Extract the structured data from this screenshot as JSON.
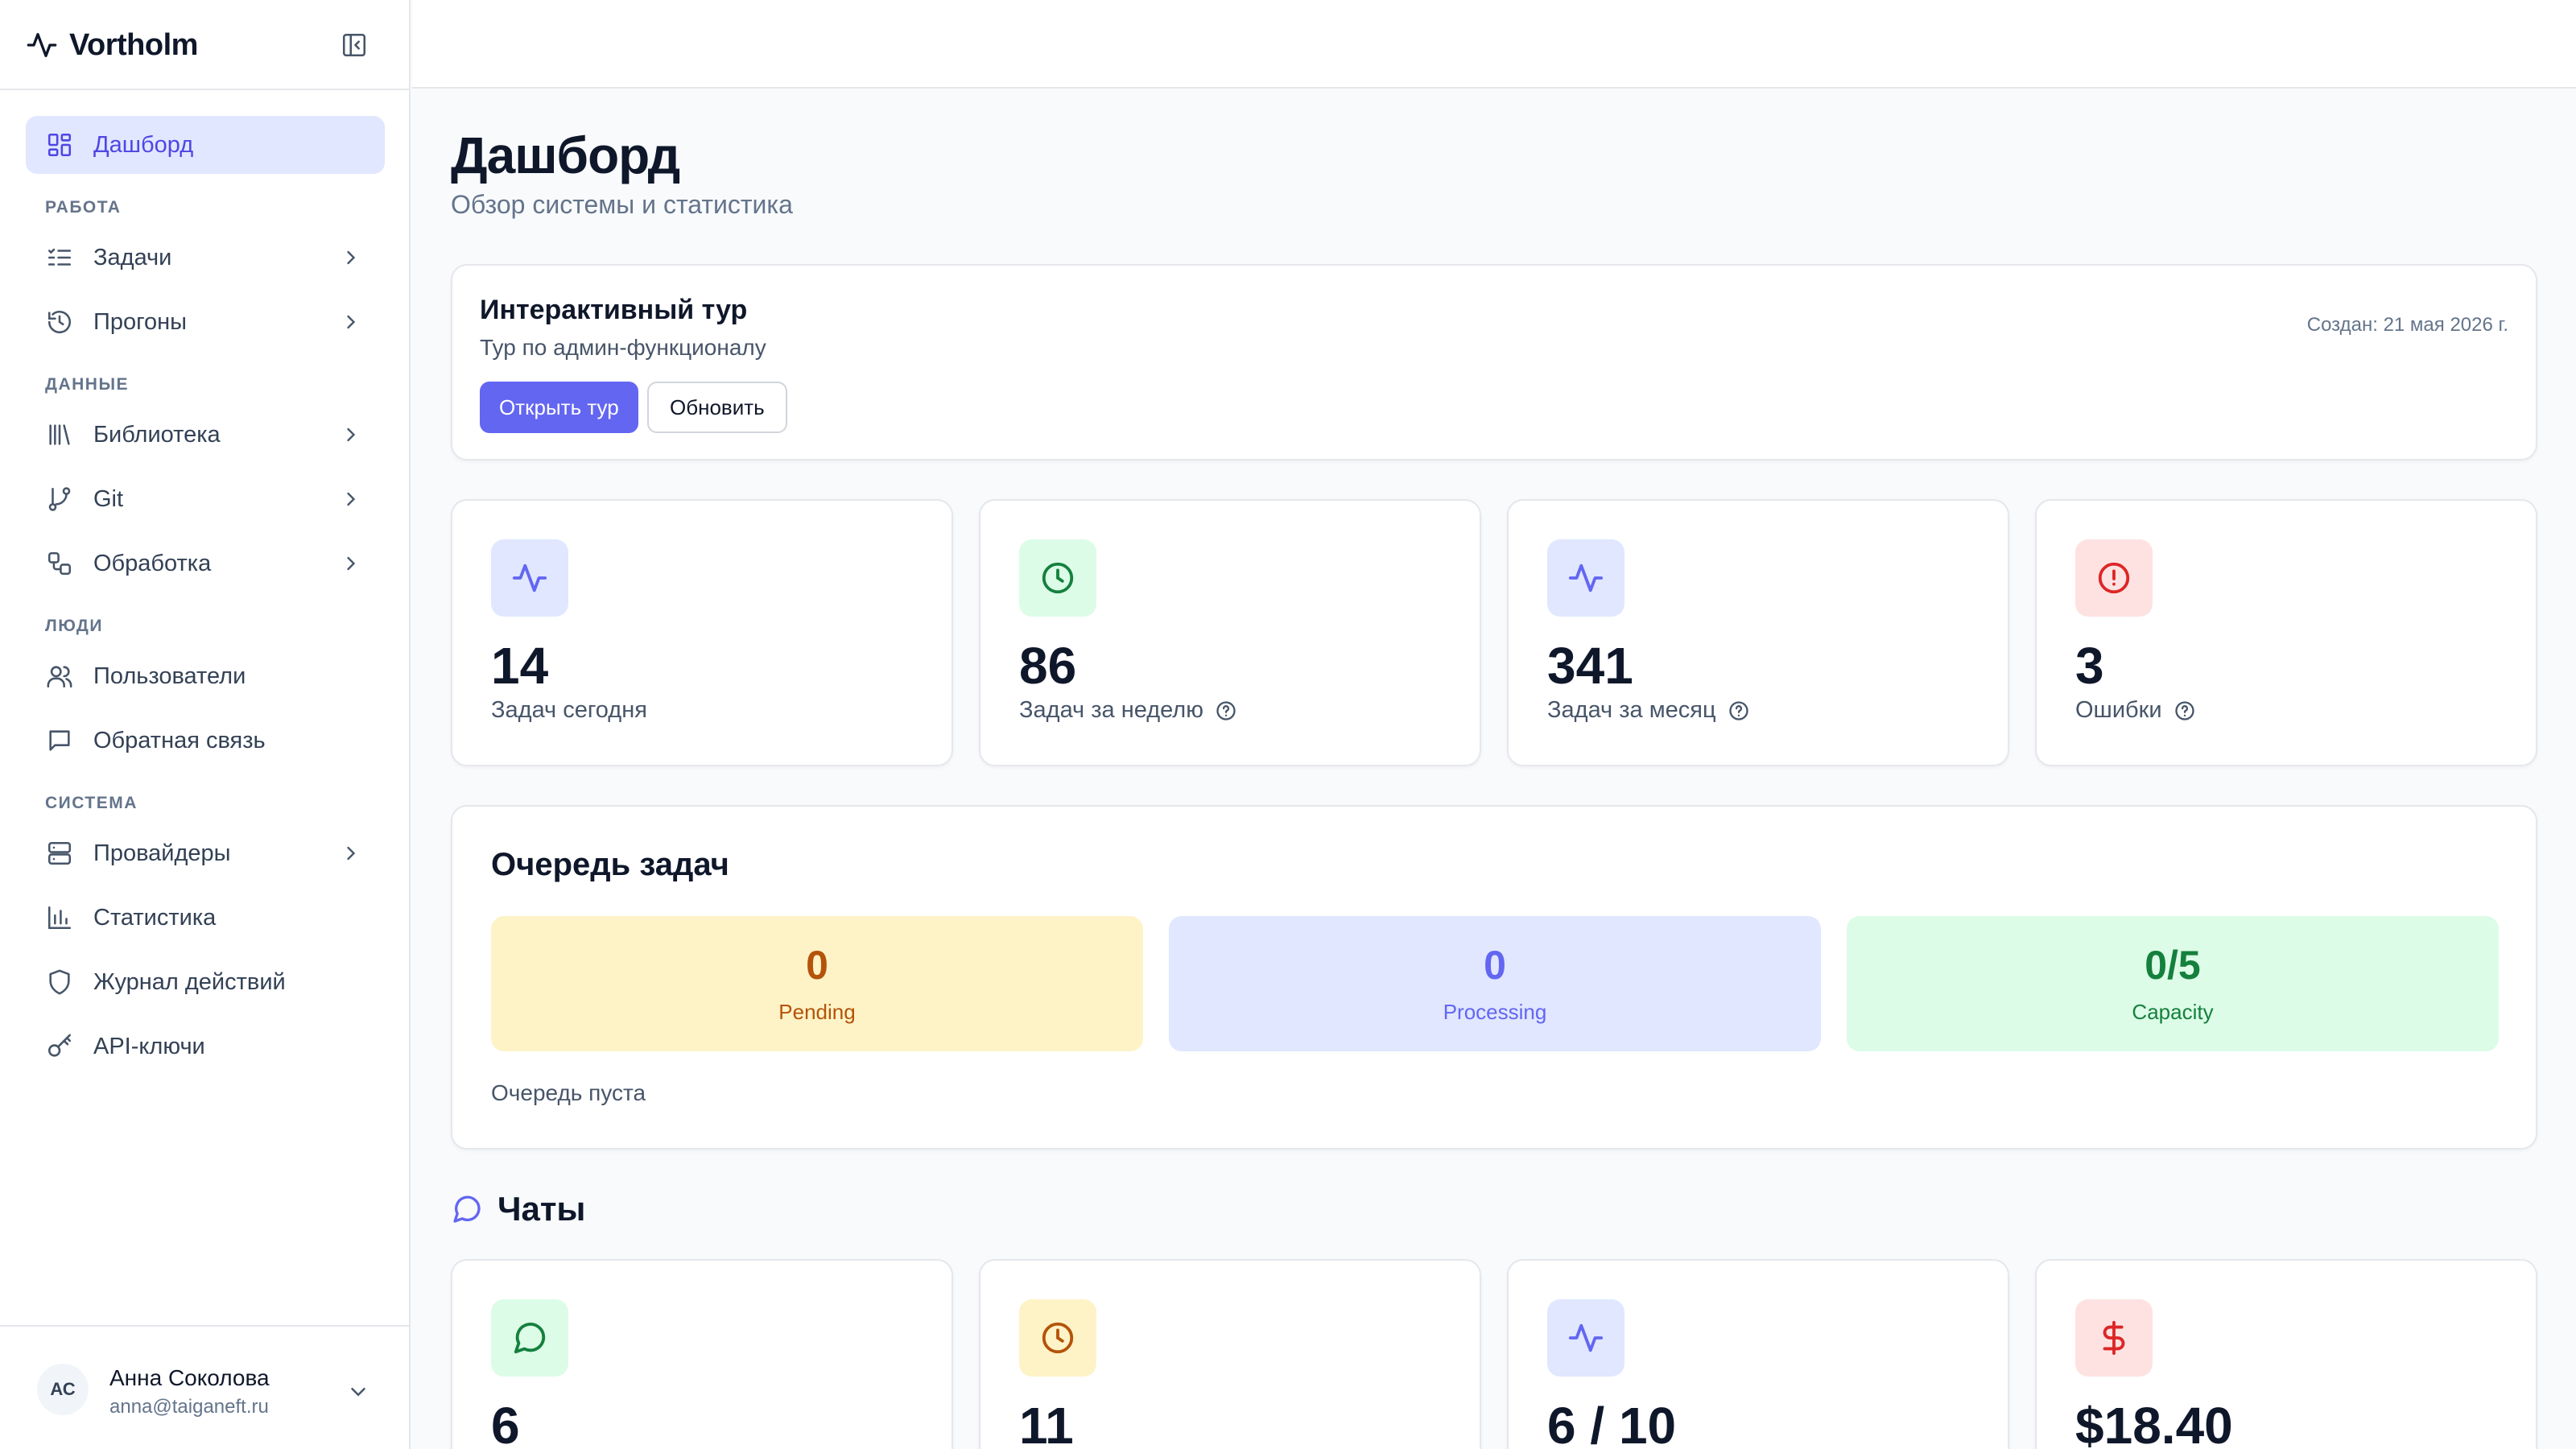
{
  "app": {
    "brand": "Vortholm"
  },
  "sidebar": {
    "top_item": {
      "label": "Дашборд",
      "icon": "grid-icon"
    },
    "sections": [
      {
        "title": "РАБОТА",
        "items": [
          {
            "label": "Задачи",
            "icon": "list-check-icon",
            "has_children": true
          },
          {
            "label": "Прогоны",
            "icon": "history-icon",
            "has_children": true
          }
        ]
      },
      {
        "title": "ДАННЫЕ",
        "items": [
          {
            "label": "Библиотека",
            "icon": "library-icon",
            "has_children": true
          },
          {
            "label": "Git",
            "icon": "git-branch-icon",
            "has_children": true
          },
          {
            "label": "Обработка",
            "icon": "workflow-icon",
            "has_children": true
          }
        ]
      },
      {
        "title": "ЛЮДИ",
        "items": [
          {
            "label": "Пользователи",
            "icon": "users-icon",
            "has_children": false
          },
          {
            "label": "Обратная связь",
            "icon": "message-square-icon",
            "has_children": false
          }
        ]
      },
      {
        "title": "СИСТЕМА",
        "items": [
          {
            "label": "Провайдеры",
            "icon": "server-icon",
            "has_children": true
          },
          {
            "label": "Статистика",
            "icon": "bar-chart-icon",
            "has_children": false
          },
          {
            "label": "Журнал действий",
            "icon": "shield-icon",
            "has_children": false
          },
          {
            "label": "API-ключи",
            "icon": "key-icon",
            "has_children": false
          }
        ]
      }
    ],
    "user": {
      "initials": "АС",
      "name": "Анна Соколова",
      "email": "anna@taiganeft.ru"
    }
  },
  "page": {
    "title": "Дашборд",
    "subtitle": "Обзор системы и статистика"
  },
  "tour": {
    "title": "Интерактивный тур",
    "description": "Тур по админ-функционалу",
    "created": "Создан: 21 мая 2026 г.",
    "open_label": "Открыть тур",
    "refresh_label": "Обновить"
  },
  "stats": [
    {
      "value": "14",
      "label": "Задач сегодня",
      "icon": "activity-icon",
      "help": false,
      "tint": "#e0e7ff",
      "color": "#6366f1"
    },
    {
      "value": "86",
      "label": "Задач за неделю",
      "icon": "clock-icon",
      "help": true,
      "tint": "#dcfce7",
      "color": "#15803d"
    },
    {
      "value": "341",
      "label": "Задач за месяц",
      "icon": "activity-icon",
      "help": true,
      "tint": "#e0e7ff",
      "color": "#6366f1"
    },
    {
      "value": "3",
      "label": "Ошибки",
      "icon": "alert-circle-icon",
      "help": true,
      "tint": "#fee2e2",
      "color": "#dc2626"
    }
  ],
  "queue": {
    "title": "Очередь задач",
    "boxes": [
      {
        "value": "0",
        "label": "Pending",
        "bg": "#fef3c7",
        "color": "#b45309"
      },
      {
        "value": "0",
        "label": "Processing",
        "bg": "#e0e7ff",
        "color": "#6366f1"
      },
      {
        "value": "0/5",
        "label": "Capacity",
        "bg": "#dcfce7",
        "color": "#15803d"
      }
    ],
    "empty_text": "Очередь пуста"
  },
  "chats": {
    "title": "Чаты",
    "cards": [
      {
        "value": "6",
        "icon": "message-circle-icon",
        "tint": "#dcfce7",
        "color": "#15803d"
      },
      {
        "value": "11",
        "icon": "clock-icon",
        "tint": "#fef3c7",
        "color": "#b45309"
      },
      {
        "value": "6 / 10",
        "icon": "activity-icon",
        "tint": "#e0e7ff",
        "color": "#6366f1"
      },
      {
        "value": "$18.40",
        "icon": "dollar-icon",
        "tint": "#fee2e2",
        "color": "#dc2626"
      }
    ]
  }
}
